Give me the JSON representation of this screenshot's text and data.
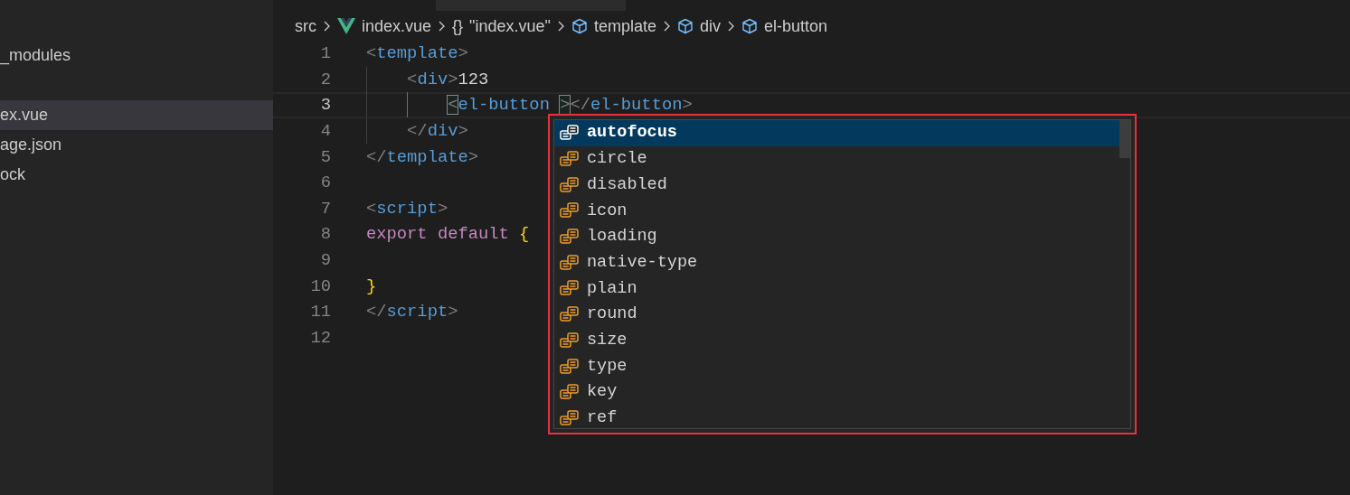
{
  "sidebar": {
    "items": [
      {
        "label": "_modules",
        "selected": false
      },
      {
        "label": "ex.vue",
        "selected": true
      },
      {
        "label": "age.json",
        "selected": false
      },
      {
        "label": "ock",
        "selected": false
      }
    ]
  },
  "breadcrumb": [
    {
      "label": "src",
      "kind": "folder"
    },
    {
      "label": "index.vue",
      "kind": "vue"
    },
    {
      "label": "\"index.vue\"",
      "kind": "module",
      "icon": "{}"
    },
    {
      "label": "template",
      "kind": "element"
    },
    {
      "label": "div",
      "kind": "element"
    },
    {
      "label": "el-button",
      "kind": "element"
    }
  ],
  "code": [
    {
      "number": "1",
      "current": false,
      "tokens": [
        {
          "text": "<",
          "kind": "punct"
        },
        {
          "text": "template",
          "kind": "tag"
        },
        {
          "text": ">",
          "kind": "punct"
        }
      ],
      "children": [
        {
          "number": "2",
          "current": false,
          "tokens": [
            {
              "text": "<",
              "kind": "punct"
            },
            {
              "text": "div",
              "kind": "tag"
            },
            {
              "text": ">",
              "kind": "punct"
            },
            {
              "text": "123",
              "kind": "text"
            }
          ],
          "children": [
            {
              "number": "3",
              "current": true,
              "tokens": [
                {
                  "text": "<",
                  "kind": "match"
                },
                {
                  "text": "el-button ",
                  "kind": "tag"
                },
                {
                  "text": ">",
                  "kind": "match"
                },
                {
                  "text": "</",
                  "kind": "punct"
                },
                {
                  "text": "el-button",
                  "kind": "tag"
                },
                {
                  "text": ">",
                  "kind": "punct"
                }
              ]
            }
          ]
        },
        {
          "number": "4",
          "current": false,
          "tokens": [
            {
              "text": "</",
              "kind": "punct"
            },
            {
              "text": "div",
              "kind": "tag"
            },
            {
              "text": ">",
              "kind": "punct"
            }
          ]
        }
      ]
    },
    {
      "number": "5",
      "current": false,
      "tokens": [
        {
          "text": "</",
          "kind": "punct"
        },
        {
          "text": "template",
          "kind": "tag"
        },
        {
          "text": ">",
          "kind": "punct"
        }
      ]
    },
    {
      "number": "6",
      "current": false
    },
    {
      "number": "7",
      "current": false,
      "tokens": [
        {
          "text": "<",
          "kind": "punct"
        },
        {
          "text": "script",
          "kind": "tag"
        },
        {
          "text": ">",
          "kind": "punct"
        }
      ]
    },
    {
      "number": "8",
      "current": false,
      "tokens": [
        {
          "text": "export default ",
          "kind": "keyword"
        },
        {
          "text": "{",
          "kind": "brace"
        }
      ]
    },
    {
      "number": "9",
      "current": false
    },
    {
      "number": "10",
      "current": false,
      "tokens": [
        {
          "text": "}",
          "kind": "brace"
        }
      ]
    },
    {
      "number": "11",
      "current": false,
      "tokens": [
        {
          "text": "</",
          "kind": "punct"
        },
        {
          "text": "script",
          "kind": "tag"
        },
        {
          "text": ">",
          "kind": "punct"
        }
      ]
    },
    {
      "number": "12",
      "current": false
    }
  ],
  "suggestions": [
    {
      "label": "autofocus",
      "selected": true
    },
    {
      "label": "circle",
      "selected": false
    },
    {
      "label": "disabled",
      "selected": false
    },
    {
      "label": "icon",
      "selected": false
    },
    {
      "label": "loading",
      "selected": false
    },
    {
      "label": "native-type",
      "selected": false
    },
    {
      "label": "plain",
      "selected": false
    },
    {
      "label": "round",
      "selected": false
    },
    {
      "label": "size",
      "selected": false
    },
    {
      "label": "type",
      "selected": false
    },
    {
      "label": "key",
      "selected": false
    },
    {
      "label": "ref",
      "selected": false
    }
  ]
}
